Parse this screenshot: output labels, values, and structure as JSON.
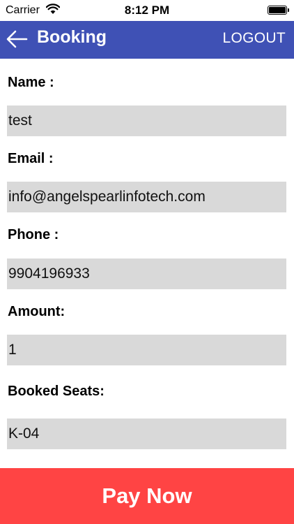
{
  "status_bar": {
    "carrier": "Carrier",
    "time": "8:12 PM",
    "wifi_icon": "wifi-icon",
    "battery_icon": "battery-icon"
  },
  "nav": {
    "back_icon": "arrow-left-icon",
    "title": "Booking",
    "logout_label": "LOGOUT",
    "background": "#3f51b5"
  },
  "form": {
    "name_label": "Name :",
    "name_value": "test",
    "email_label": "Email :",
    "email_value": "info@angelspearlinfotech.com",
    "phone_label": "Phone :",
    "phone_value": "9904196933",
    "amount_label": "Amount:",
    "amount_value": "1",
    "seats_label": "Booked Seats:",
    "seats_value": "K-04",
    "field_background": "#d9d9d9"
  },
  "actions": {
    "pay_now_label": "Pay Now",
    "pay_now_color": "#ff4444"
  }
}
